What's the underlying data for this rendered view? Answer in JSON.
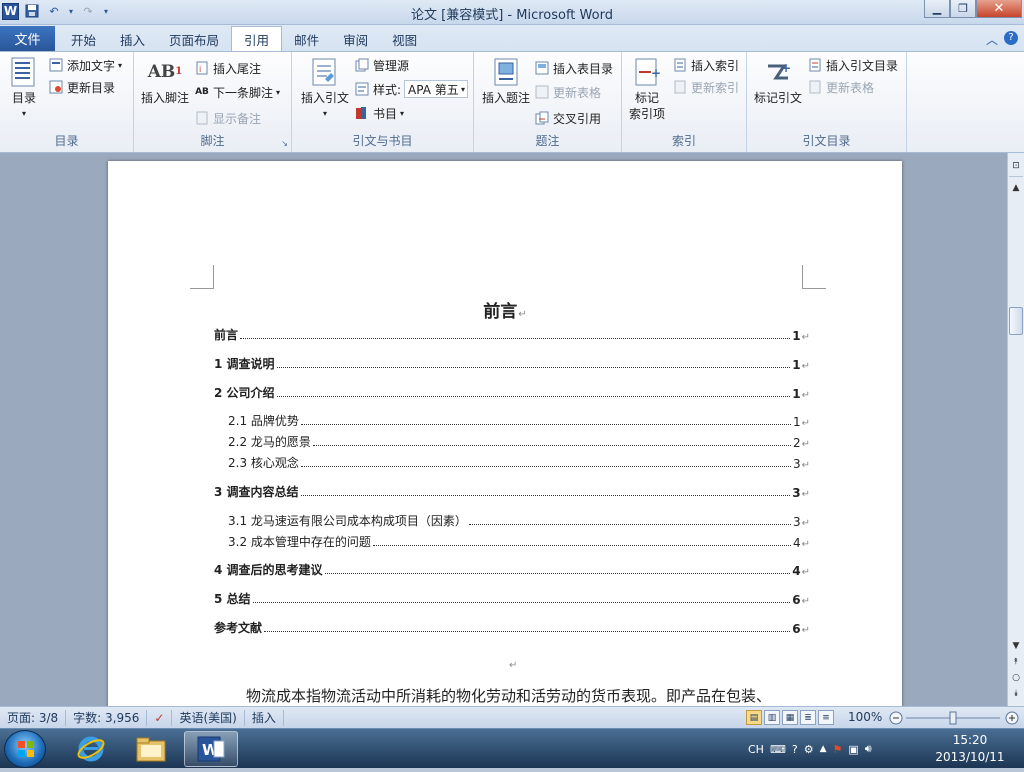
{
  "window": {
    "title": "论文 [兼容模式]  -  Microsoft Word"
  },
  "qat": {
    "undo": "↶",
    "redo": "↷"
  },
  "tabs": {
    "file": "文件",
    "items": [
      "开始",
      "插入",
      "页面布局",
      "引用",
      "邮件",
      "审阅",
      "视图"
    ],
    "active": "引用"
  },
  "ribbon": {
    "toc": {
      "label": "目录",
      "toc_button": "目录",
      "add_text": "添加文字",
      "update_toc": "更新目录"
    },
    "footnotes": {
      "label": "脚注",
      "insert_footnote": "插入脚注",
      "insert_endnote": "插入尾注",
      "next_footnote": "下一条脚注",
      "show_notes": "显示备注"
    },
    "citations": {
      "label": "引文与书目",
      "insert_citation": "插入引文",
      "manage_sources": "管理源",
      "style_label": "样式:",
      "style_value": "APA 第五",
      "bibliography": "书目"
    },
    "captions": {
      "label": "题注",
      "insert_caption": "插入题注",
      "insert_tof": "插入表目录",
      "update_table": "更新表格",
      "cross_reference": "交叉引用"
    },
    "index": {
      "label": "索引",
      "mark_entry_1": "标记",
      "mark_entry_2": "索引项",
      "insert_index": "插入索引",
      "update_index": "更新索引"
    },
    "toa": {
      "label": "引文目录",
      "mark_citation": "标记引文",
      "insert_toa": "插入引文目录",
      "update_table": "更新表格"
    }
  },
  "document": {
    "heading": "前言",
    "toc_entries": [
      {
        "level": 1,
        "label": "前言",
        "page": "1"
      },
      {
        "level": 1,
        "label": "1  调查说明",
        "page": "1"
      },
      {
        "level": 1,
        "label": "2  公司介绍",
        "page": "1"
      },
      {
        "level": 2,
        "label": "2.1  品牌优势",
        "page": "1"
      },
      {
        "level": 2,
        "label": "2.2  龙马的愿景",
        "page": "2"
      },
      {
        "level": 2,
        "label": "2.3  核心观念",
        "page": "3"
      },
      {
        "level": 1,
        "label": "3  调查内容总结",
        "page": "3"
      },
      {
        "level": 2,
        "label": "3.1  龙马速运有限公司成本构成项目（因素）",
        "page": "3"
      },
      {
        "level": 2,
        "label": "3.2  成本管理中存在的问题",
        "page": "4"
      },
      {
        "level": 1,
        "label": "4  调查后的思考建议",
        "page": "4"
      },
      {
        "level": 1,
        "label": "5  总结",
        "page": "6"
      },
      {
        "level": 1,
        "label": "参考文献",
        "page": "6"
      }
    ],
    "para_mark": "↵",
    "body_text": "物流成本指物流活动中所消耗的物化劳动和活劳动的货币表现。即产品在包装、"
  },
  "statusbar": {
    "page": "页面: 3/8",
    "words": "字数: 3,956",
    "language": "英语(美国)",
    "mode": "插入",
    "zoom": "100%"
  },
  "taskbar": {
    "ime": "CH",
    "time": "15:20",
    "date": "2013/10/11"
  }
}
